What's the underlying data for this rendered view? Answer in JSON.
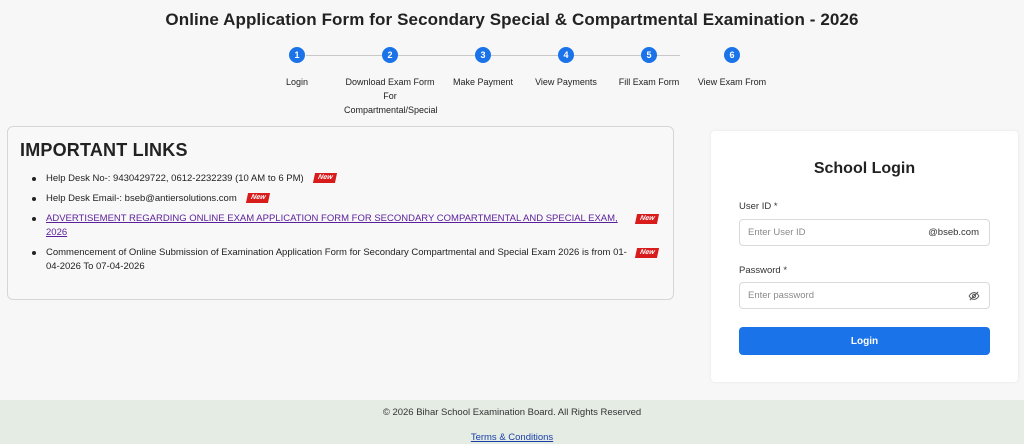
{
  "header": {
    "title": "Online Application Form for Secondary Special & Compartmental Examination - 2026"
  },
  "steps": [
    {
      "number": "1",
      "label": "Login"
    },
    {
      "number": "2",
      "label": "Download Exam Form For Compartmental/Special"
    },
    {
      "number": "3",
      "label": "Make Payment"
    },
    {
      "number": "4",
      "label": "View Payments"
    },
    {
      "number": "5",
      "label": "Fill Exam Form"
    },
    {
      "number": "6",
      "label": "View Exam From"
    }
  ],
  "links": {
    "heading": "IMPORTANT LINKS",
    "badge": "New",
    "items": [
      {
        "text": "Help Desk No-: 9430429722, 0612-2232239 (10 AM to 6 PM)"
      },
      {
        "text": "Help Desk Email-: bseb@antiersolutions.com"
      },
      {
        "text": "ADVERTISEMENT REGARDING ONLINE EXAM APPLICATION FORM FOR SECONDARY COMPARTMENTAL AND SPECIAL EXAM, 2026"
      },
      {
        "text": "Commencement of Online Submission of Examination Application Form for Secondary Compartmental and Special Exam 2026 is from 01-04-2026 To 07-04-2026"
      }
    ]
  },
  "login": {
    "title": "School Login",
    "user_id_label": "User ID",
    "user_id_placeholder": "Enter User ID",
    "user_id_suffix": "@bseb.com",
    "password_label": "Password",
    "password_placeholder": "Enter password",
    "required_mark": "*",
    "button_label": "Login"
  },
  "footer": {
    "copyright": "© 2026 Bihar School Examination Board. All Rights Reserved",
    "terms": "Terms & Conditions"
  },
  "colors": {
    "accent": "#1a73e8",
    "badge": "#d81b1b",
    "footer_bg": "#e4ece4",
    "link": "#5a1f9a"
  }
}
